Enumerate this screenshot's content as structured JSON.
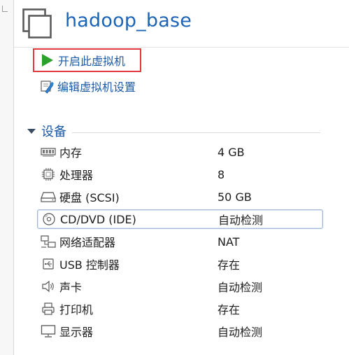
{
  "vm": {
    "title": "hadoop_base"
  },
  "actions": {
    "start_label": "开启此虚拟机",
    "edit_label": "编辑虚拟机设置"
  },
  "devices_section": {
    "title": "设备",
    "items": [
      {
        "name": "内存",
        "value": "4 GB",
        "icon": "memory-icon"
      },
      {
        "name": "处理器",
        "value": "8",
        "icon": "processor-icon"
      },
      {
        "name": "硬盘 (SCSI)",
        "value": "50 GB",
        "icon": "hard-disk-icon"
      },
      {
        "name": "CD/DVD (IDE)",
        "value": "自动检测",
        "icon": "cd-dvd-icon",
        "selected": true
      },
      {
        "name": "网络适配器",
        "value": "NAT",
        "icon": "network-adapter-icon"
      },
      {
        "name": "USB 控制器",
        "value": "存在",
        "icon": "usb-icon"
      },
      {
        "name": "声卡",
        "value": "自动检测",
        "icon": "speaker-icon"
      },
      {
        "name": "打印机",
        "value": "存在",
        "icon": "printer-icon"
      },
      {
        "name": "显示器",
        "value": "自动检测",
        "icon": "monitor-icon"
      }
    ]
  },
  "colors": {
    "title_blue": "#1b64b8",
    "link_blue": "#1c5aa6",
    "start_green": "#2aa12a",
    "highlight_red": "#e0393e",
    "selection_border": "#9bb6d6"
  }
}
